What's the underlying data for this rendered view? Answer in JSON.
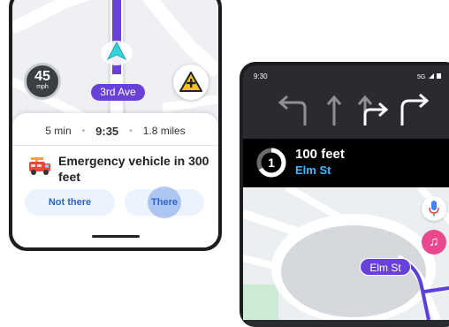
{
  "left_phone": {
    "speed": {
      "value": "45",
      "unit": "mph"
    },
    "street_label": "3rd Ave",
    "report_icon": "warning-plus-icon",
    "eta": {
      "duration": "5 min",
      "arrival": "9:35",
      "distance": "1.8 miles"
    },
    "alert": {
      "icon": "fire-truck-icon",
      "text": "Emergency vehicle in 300 feet"
    },
    "buttons": {
      "not_there": "Not there",
      "there": "There"
    }
  },
  "right_phone": {
    "status": {
      "time": "9:30",
      "network": "5G"
    },
    "lanes": [
      "left-arrow",
      "straight-arrow",
      "straight-right-arrow",
      "right-arrow"
    ],
    "instruction": {
      "step": "1",
      "distance": "100 feet",
      "street": "Elm St"
    },
    "map_street_label": "Elm St",
    "side_buttons": [
      "mic-icon",
      "music-icon"
    ]
  },
  "colors": {
    "accent_purple": "#6a41d8",
    "button_blue": "#2d64c8",
    "street_blue": "#3fb7ff",
    "music_pink": "#e9488f"
  }
}
